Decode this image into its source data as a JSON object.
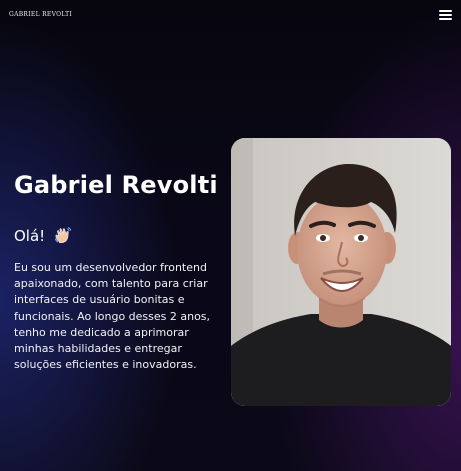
{
  "header": {
    "logo_text": "Gabriel Revolti",
    "menu_icon": "hamburger-menu-icon"
  },
  "hero": {
    "name": "Gabriel Revolti",
    "greeting": "Olá!",
    "greeting_icon": "waving-hand-icon",
    "bio": "Eu sou um desenvolvedor frontend apaixonado, com talento para criar interfaces de usuário bonitas e funcionais. Ao longo desses 2 anos, tenho me dedicado a aprimorar minhas habilidades e entregar soluções eficientes e inovadoras."
  },
  "colors": {
    "background": "#08071a",
    "accent_blue": "#2837a0",
    "accent_purple": "#551978",
    "text": "#ffffff"
  }
}
